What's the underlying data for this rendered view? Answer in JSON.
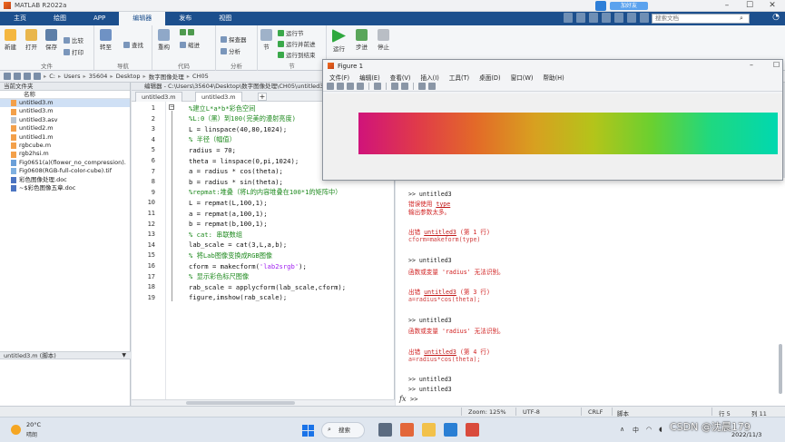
{
  "window": {
    "title": "MATLAB R2022a",
    "share_label": "加好友"
  },
  "ribbon_tabs": [
    "主页",
    "绘图",
    "APP",
    "编辑器",
    "发布",
    "视图"
  ],
  "ribbon_search_placeholder": "搜索文档",
  "ribbon": {
    "file_group": {
      "new": "新建",
      "open": "打开",
      "save": "保存",
      "compare": "比较",
      "print": "打印",
      "label": "文件"
    },
    "nav_group": {
      "goto": "转至",
      "find": "查找",
      "label": "导航"
    },
    "edit_group": {
      "refactor": "重构",
      "indent": "缩进",
      "label": "代码"
    },
    "analyze_group": {
      "analyze": "分析",
      "profiler": "探查器",
      "label": "分析"
    },
    "section_group": {
      "section": "节",
      "run_section": "运行节",
      "advance": "运行并前进",
      "run_advance": "运行到结束",
      "label": "节"
    },
    "run_group": {
      "run": "运行",
      "step": "步进",
      "stop": "停止",
      "label": "运行"
    }
  },
  "address": {
    "crumbs": [
      "C:",
      "Users",
      "35604",
      "Desktop",
      "数字图像处理",
      "CH05"
    ]
  },
  "folder_pane": {
    "title": "当前文件夹",
    "col_name": "名称",
    "files": [
      {
        "name": "untitled3.m",
        "type": "m",
        "selected": true
      },
      {
        "name": "untitled3.m",
        "type": "m"
      },
      {
        "name": "untitled3.asv",
        "type": "asv"
      },
      {
        "name": "untitled2.m",
        "type": "m"
      },
      {
        "name": "untitled1.m",
        "type": "m"
      },
      {
        "name": "rgbcube.m",
        "type": "m"
      },
      {
        "name": "rgb2hsi.m",
        "type": "m"
      },
      {
        "name": "Fig0651(a)(flower_no_compression).",
        "type": "fig"
      },
      {
        "name": "Fig0608(RGB-full-color-cube).tif",
        "type": "tif"
      },
      {
        "name": "彩色图像处理.doc",
        "type": "doc"
      },
      {
        "name": "~$彩色图像五章.doc",
        "type": "doc"
      }
    ],
    "detail": "untitled3.m (脚本)"
  },
  "editor": {
    "title": "编辑器 - C:\\Users\\35604\\Desktop\\数字图像处理\\CH05\\untitled3.m",
    "tabs": [
      "untitled3.m",
      "untitled3.m"
    ],
    "lines": [
      {
        "n": "1",
        "t": "%建立L*a*b*彩色空间",
        "cm": true
      },
      {
        "n": "2",
        "t": "%L:0（黑）到100(完美的漫射亮度)",
        "cm": true
      },
      {
        "n": "3",
        "t": "L = linspace(40,80,1024);"
      },
      {
        "n": "4",
        "t": "% 半径（幅值）",
        "cm": true
      },
      {
        "n": "5",
        "t": "radius = 70;"
      },
      {
        "n": "6",
        "t": "theta = linspace(0,pi,1024);"
      },
      {
        "n": "7",
        "t": "a = radius * cos(theta);"
      },
      {
        "n": "8",
        "t": "b = radius * sin(theta);"
      },
      {
        "n": "9",
        "t": "%repmat:堆叠（将L的内容堆叠在100*1的矩阵中）",
        "cm": true
      },
      {
        "n": "10",
        "t": "L = repmat(L,100,1);"
      },
      {
        "n": "11",
        "t": "a = repmat(a,100,1);"
      },
      {
        "n": "12",
        "t": "b = repmat(b,100,1);"
      },
      {
        "n": "13",
        "t": "% cat: 串联数组",
        "cm": true
      },
      {
        "n": "14",
        "t": "lab_scale = cat(3,L,a,b);"
      },
      {
        "n": "15",
        "t": "% 将Lab图像变换成RGB图像",
        "cm": true
      },
      {
        "n": "16",
        "pre": "cform = makecform(",
        "s": "'lab2srgb'",
        "post": ");"
      },
      {
        "n": "17",
        "t": "% 显示彩色标尺图像",
        "cm": true
      },
      {
        "n": "18",
        "t": "rab_scale = applycform(lab_scale,cform);"
      },
      {
        "n": "19",
        "t": "figure,imshow(rab_scale);"
      }
    ]
  },
  "command_window": {
    "lines": [
      {
        "cls": "prompt",
        "t": ">> untitled3"
      },
      {
        "cls": "err",
        "pre": "错误使用 ",
        "link": "type",
        "post": ""
      },
      {
        "cls": "err",
        "t": "输出参数太多。"
      },
      {
        "cls": "err",
        "pre": "出错 ",
        "link": "untitled3",
        "post": " (第 1 行)"
      },
      {
        "cls": "note",
        "t": "cform=makeform(type)"
      },
      {
        "cls": "prompt",
        "t": ">> untitled3"
      },
      {
        "cls": "err",
        "t": "函数或变量 'radius' 无法识别。"
      },
      {
        "cls": "err",
        "pre": "出错 ",
        "link": "untitled3",
        "post": " (第 3 行)"
      },
      {
        "cls": "note",
        "t": "a=radius*cos(theta);"
      },
      {
        "cls": "prompt",
        "t": ">> untitled3"
      },
      {
        "cls": "err",
        "t": "函数或变量 'radius' 无法识别。"
      },
      {
        "cls": "err",
        "pre": "出错 ",
        "link": "untitled3",
        "post": " (第 4 行)"
      },
      {
        "cls": "note",
        "t": "a=radius*cos(theta);"
      },
      {
        "cls": "prompt",
        "t": ">> untitled3"
      },
      {
        "cls": "prompt",
        "t": ">> untitled3"
      }
    ],
    "prompt": ">>"
  },
  "statusbar": {
    "zoom": "Zoom: 125%",
    "encoding": "UTF-8",
    "eol": "CRLF",
    "type": "脚本",
    "row": "行 5",
    "col": "列 11"
  },
  "figure": {
    "title": "Figure 1",
    "menu": [
      "文件(F)",
      "编辑(E)",
      "查看(V)",
      "插入(I)",
      "工具(T)",
      "桌面(D)",
      "窗口(W)",
      "帮助(H)"
    ]
  },
  "taskbar": {
    "temp": "20°C",
    "weather": "晴朗",
    "search": "搜索",
    "lang": "中",
    "time": "",
    "date": "2022/11/3"
  },
  "watermark": "CSDN @沈晨179",
  "colors": {
    "ribbon_blue": "#1c4f8d",
    "comment_green": "#1f8a1f",
    "string_purple": "#a020f0",
    "error_red": "#d02020"
  }
}
